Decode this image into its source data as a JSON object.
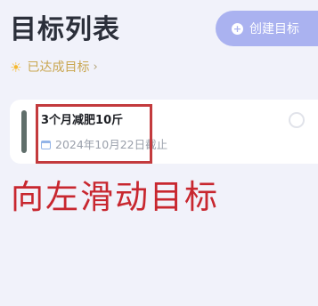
{
  "header": {
    "title": "目标列表",
    "create_button_label": "创建目标",
    "create_button_icon": "plus-icon"
  },
  "achieved_link": {
    "icon": "sun-icon",
    "label": "已达成目标",
    "chevron": "›"
  },
  "goals": [
    {
      "title": "3个月减肥10斤",
      "deadline": "2024年10月22日",
      "deadline_suffix": "截止",
      "bar_color": "#5f6e6a"
    }
  ],
  "annotation": {
    "text": "向左滑动目标",
    "color": "#c8272f"
  },
  "colors": {
    "background": "#f1f2fa",
    "accent": "#aab2f0",
    "highlight": "#c33a3d"
  }
}
